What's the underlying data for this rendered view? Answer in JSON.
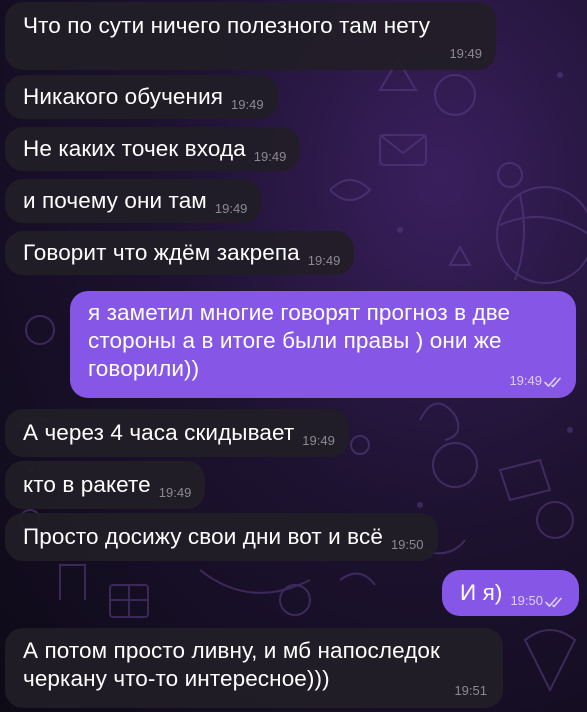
{
  "messages": [
    {
      "direction": "in",
      "text": "Что по сути ничего полезного там нету",
      "time": "19:49"
    },
    {
      "direction": "in",
      "text": "Никакого обучения",
      "time": "19:49"
    },
    {
      "direction": "in",
      "text": "Не каких точек входа",
      "time": "19:49"
    },
    {
      "direction": "in",
      "text": "и почему они там",
      "time": "19:49"
    },
    {
      "direction": "in",
      "text": "Говорит что ждём закрепа",
      "time": "19:49"
    },
    {
      "direction": "out",
      "text": "я заметил многие говорят прогноз в две\nстороны а в итоге были правы ) они же\nговорили))",
      "time": "19:49",
      "read": true
    },
    {
      "direction": "in",
      "text": "А через 4 часа скидывает",
      "time": "19:49"
    },
    {
      "direction": "in",
      "text": "кто в ракете",
      "time": "19:49"
    },
    {
      "direction": "in",
      "text": "Просто досижу свои дни вот и всё",
      "time": "19:50"
    },
    {
      "direction": "out",
      "text": "И я)",
      "time": "19:50",
      "read": true
    },
    {
      "direction": "in",
      "text": "А потом просто ливну, и мб напоследок\nчеркану что-то интересное)))",
      "time": "19:51"
    }
  ],
  "colors": {
    "incoming_bubble": "#211e27",
    "outgoing_bubble": "#8657e6",
    "text": "#ffffff",
    "incoming_time": "#8c8996",
    "outgoing_time": "#dcd0fb"
  }
}
